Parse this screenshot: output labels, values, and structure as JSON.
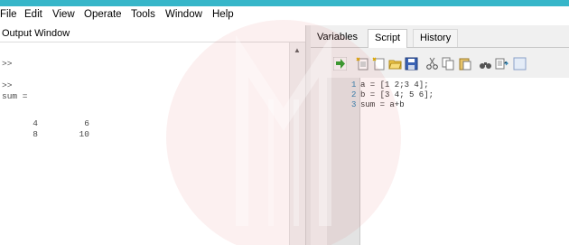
{
  "menu": [
    "File",
    "Edit",
    "View",
    "Operate",
    "Tools",
    "Window",
    "Help"
  ],
  "output": {
    "title": "Output Window",
    "lines": [
      ">>",
      ">>",
      "sum =",
      "",
      "      4         6",
      "      8        10"
    ]
  },
  "right_tabs": [
    "Variables",
    "Script",
    "History"
  ],
  "active_tab": "Script",
  "toolbar_icons": [
    "run-icon",
    "new-script-icon",
    "new-file-icon",
    "open-folder-icon",
    "save-icon",
    "cut-icon",
    "copy-icon",
    "paste-icon",
    "find-icon",
    "replace-icon",
    "more-icon"
  ],
  "script": {
    "line_numbers": [
      "1",
      "2",
      "3"
    ],
    "lines": [
      "a = [1 2;3 4];",
      "b = [3 4; 5 6];",
      "sum = a+b"
    ]
  },
  "colors": {
    "title_bar": "#37b6c9",
    "run_green": "#2e9e2e",
    "watermark": "#e15a5a"
  }
}
